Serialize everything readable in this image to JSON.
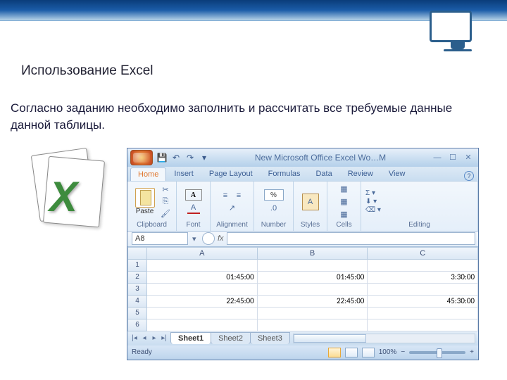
{
  "slide": {
    "title": "Использование Excel",
    "text": "Согласно заданию необходимо заполнить и рассчитать все требуемые данные данной таблицы."
  },
  "window": {
    "title": "New Microsoft Office Excel Wo…M",
    "qat_icons": [
      "save-icon",
      "undo-icon",
      "redo-icon"
    ]
  },
  "ribbon_tabs": [
    "Home",
    "Insert",
    "Page Layout",
    "Formulas",
    "Data",
    "Review",
    "View"
  ],
  "ribbon_groups": {
    "clipboard": "Clipboard",
    "paste": "Paste",
    "font": "Font",
    "alignment": "Alignment",
    "number": "Number",
    "styles": "Styles",
    "cells": "Cells",
    "editing": "Editing"
  },
  "name_box": "A8",
  "fx_label": "fx",
  "columns": [
    "A",
    "B",
    "C"
  ],
  "rows": [
    {
      "n": "1",
      "cells": [
        "",
        "",
        ""
      ]
    },
    {
      "n": "2",
      "cells": [
        "01:45:00",
        "01:45:00",
        "3:30:00"
      ]
    },
    {
      "n": "3",
      "cells": [
        "",
        "",
        ""
      ]
    },
    {
      "n": "4",
      "cells": [
        "22:45:00",
        "22:45:00",
        "45:30:00"
      ]
    },
    {
      "n": "5",
      "cells": [
        "",
        "",
        ""
      ]
    },
    {
      "n": "6",
      "cells": [
        "",
        "",
        ""
      ]
    }
  ],
  "sheets": [
    "Sheet1",
    "Sheet2",
    "Sheet3"
  ],
  "statusbar": {
    "ready": "Ready",
    "zoom": "100%"
  }
}
